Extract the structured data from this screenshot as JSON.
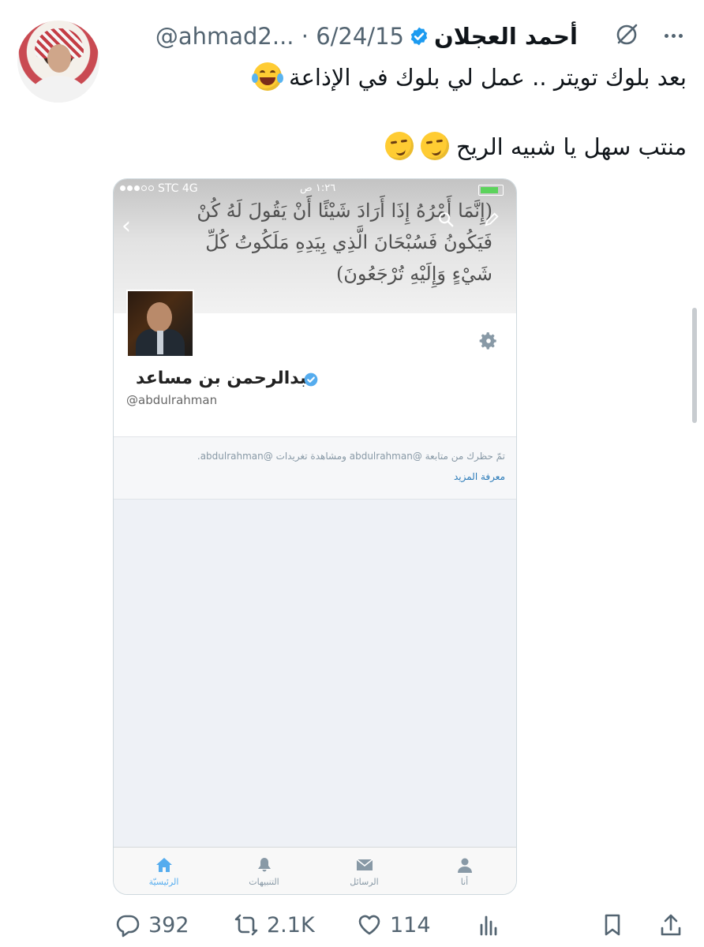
{
  "tweet": {
    "author_name": "أحمد العجلان",
    "handle": "@ahmad2...",
    "separator": "·",
    "date": "6/24/15",
    "line1": "بعد بلوك تويتر .. عمل لي بلوك في الإذاعة",
    "line2": "منتب سهل يا شبيه الريح",
    "line1_emoji": "face-with-tears-of-joy",
    "line2_emojis": [
      "smirking-face",
      "smirking-face"
    ]
  },
  "embedded_screenshot": {
    "status_bar": {
      "carrier": "STC 4G",
      "clock": "١:٢٦ ص"
    },
    "banner_text": "(إِنَّمَا أَمْرُهُ إِذَا أَرَادَ شَيْئًا أَنْ يَقُولَ لَهُ كُنْ فَيَكُونُ فَسُبْحَانَ الَّذِي بِيَدِهِ مَلَكُوتُ كُلِّ شَيْءٍ وَإِلَيْهِ تُرْجَعُونَ)",
    "profile": {
      "name": "عبدالرحمن بن مساعد",
      "handle": "@abdulrahman"
    },
    "block_notice": "تمّ حظرك من متابعة @abdulrahman ومشاهدة تغريدات @abdulrahman.",
    "learn_more": "معرفة المزيد",
    "tabs": [
      {
        "label": "الرئيسيّة",
        "icon": "home-icon",
        "active": true
      },
      {
        "label": "التنبيهات",
        "icon": "bell-icon",
        "active": false
      },
      {
        "label": "الرسائل",
        "icon": "envelope-icon",
        "active": false
      },
      {
        "label": "أنا",
        "icon": "person-icon",
        "active": false
      }
    ]
  },
  "metrics": {
    "replies": "392",
    "retweets": "2.1K",
    "likes": "114"
  },
  "colors": {
    "verified": "#1d9bf0",
    "text": "#0f1419",
    "muted": "#536471",
    "tab_active": "#55acee"
  }
}
